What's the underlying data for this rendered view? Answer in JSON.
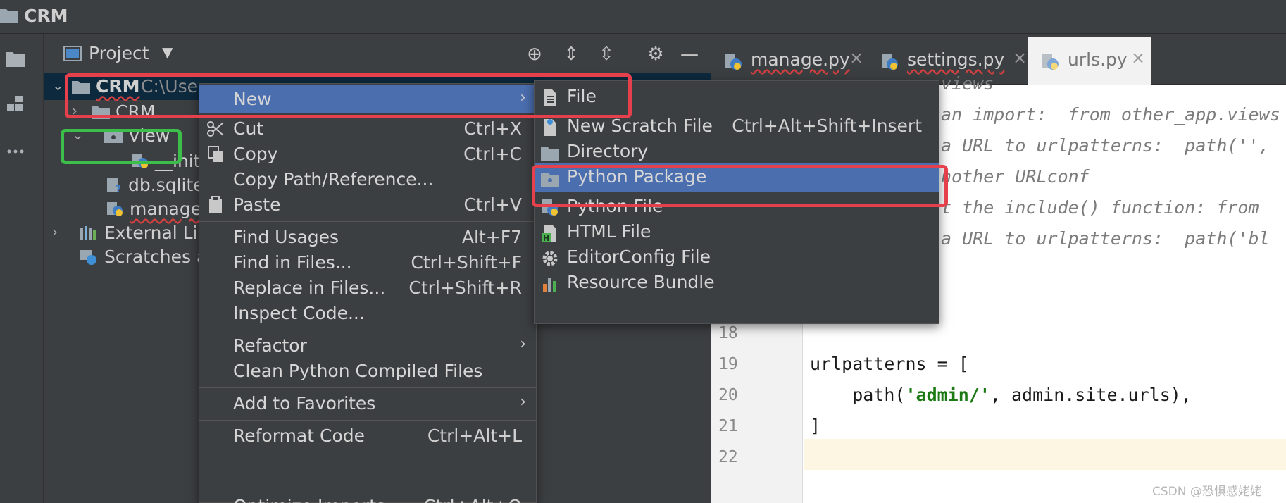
{
  "app": {
    "title": "CRM"
  },
  "project_panel": {
    "title": "Project",
    "tools": [
      "locate-icon",
      "expand-all-icon",
      "collapse-all-icon",
      "gear-icon",
      "minimize-icon"
    ],
    "tree": [
      {
        "label": "CRM",
        "hint": "C:\\Use",
        "icon": "folder-icon"
      },
      {
        "label": "CRM",
        "icon": "folder-icon"
      },
      {
        "label": "View",
        "icon": "folder-icon"
      },
      {
        "label": "__init_",
        "icon": "python-icon"
      },
      {
        "label": "db.sqlite",
        "icon": "db-icon"
      },
      {
        "label": "manage.",
        "icon": "python-icon"
      },
      {
        "label": "External Libr",
        "icon": "library-icon"
      },
      {
        "label": "Scratches ar",
        "icon": "scratches-icon"
      }
    ]
  },
  "editor_tabs": [
    {
      "label": "manage.py",
      "active": false
    },
    {
      "label": "settings.py",
      "active": false
    },
    {
      "label": "urls.py",
      "active": true
    }
  ],
  "editor": {
    "partial_lines": [
      "views",
      "an import:  from other_app.views",
      "a URL to urlpatterns:  path('',",
      "nother URLconf",
      "t the include() function: from",
      "a URL to urlpatterns:  path('bl"
    ],
    "line_numbers": [
      "18",
      "19",
      "20",
      "21",
      "22"
    ],
    "code_lines": [
      {
        "num": "19",
        "text": "urlpatterns = ["
      },
      {
        "num": "20",
        "pre": "    path(",
        "str": "'admin/'",
        "post": ", admin.site.urls),"
      },
      {
        "num": "21",
        "text": "]"
      },
      {
        "num": "22",
        "text": ""
      }
    ]
  },
  "context_menu": {
    "items": [
      {
        "label": "New",
        "shortcut": "",
        "submenu": true,
        "highlighted": true,
        "icon": ""
      },
      {
        "label": "Cut",
        "shortcut": "Ctrl+X",
        "icon": "scissors-icon"
      },
      {
        "label": "Copy",
        "shortcut": "Ctrl+C",
        "icon": "copy-icon"
      },
      {
        "label": "Copy Path/Reference...",
        "shortcut": ""
      },
      {
        "label": "Paste",
        "shortcut": "Ctrl+V",
        "icon": "paste-icon"
      },
      {
        "label": "Find Usages",
        "shortcut": "Alt+F7"
      },
      {
        "label": "Find in Files...",
        "shortcut": "Ctrl+Shift+F"
      },
      {
        "label": "Replace in Files...",
        "shortcut": "Ctrl+Shift+R"
      },
      {
        "label": "Inspect Code...",
        "shortcut": ""
      },
      {
        "label": "Refactor",
        "shortcut": "",
        "submenu": true
      },
      {
        "label": "Clean Python Compiled Files",
        "shortcut": ""
      },
      {
        "label": "Add to Favorites",
        "shortcut": "",
        "submenu": true
      },
      {
        "label": "Reformat Code",
        "shortcut": "Ctrl+Alt+L"
      },
      {
        "label": "Optimize Imports",
        "shortcut": "Ctrl+Alt+O"
      }
    ]
  },
  "new_submenu": {
    "items": [
      {
        "label": "File",
        "shortcut": "",
        "icon": "file-icon"
      },
      {
        "label": "New Scratch File",
        "shortcut": "Ctrl+Alt+Shift+Insert",
        "icon": "scratch-file-icon"
      },
      {
        "label": "Directory",
        "shortcut": "",
        "icon": "folder-icon"
      },
      {
        "label": "Python Package",
        "shortcut": "",
        "icon": "package-icon",
        "highlighted": true
      },
      {
        "label": "Python File",
        "shortcut": "",
        "icon": "python-icon"
      },
      {
        "label": "HTML File",
        "shortcut": "",
        "icon": "html-icon"
      },
      {
        "label": "EditorConfig File",
        "shortcut": "",
        "icon": "gear-icon"
      },
      {
        "label": "Resource Bundle",
        "shortcut": "",
        "icon": "bundle-icon"
      }
    ]
  },
  "watermark": "CSDN @恐惧感姥姥",
  "colors": {
    "highlight": "#4b6eaf",
    "annotation_red": "#e5404c",
    "annotation_green": "#3cbf4a",
    "menu_bg": "#3c3f41",
    "editor_bg": "#ffffff",
    "string": "#1b7a13"
  }
}
